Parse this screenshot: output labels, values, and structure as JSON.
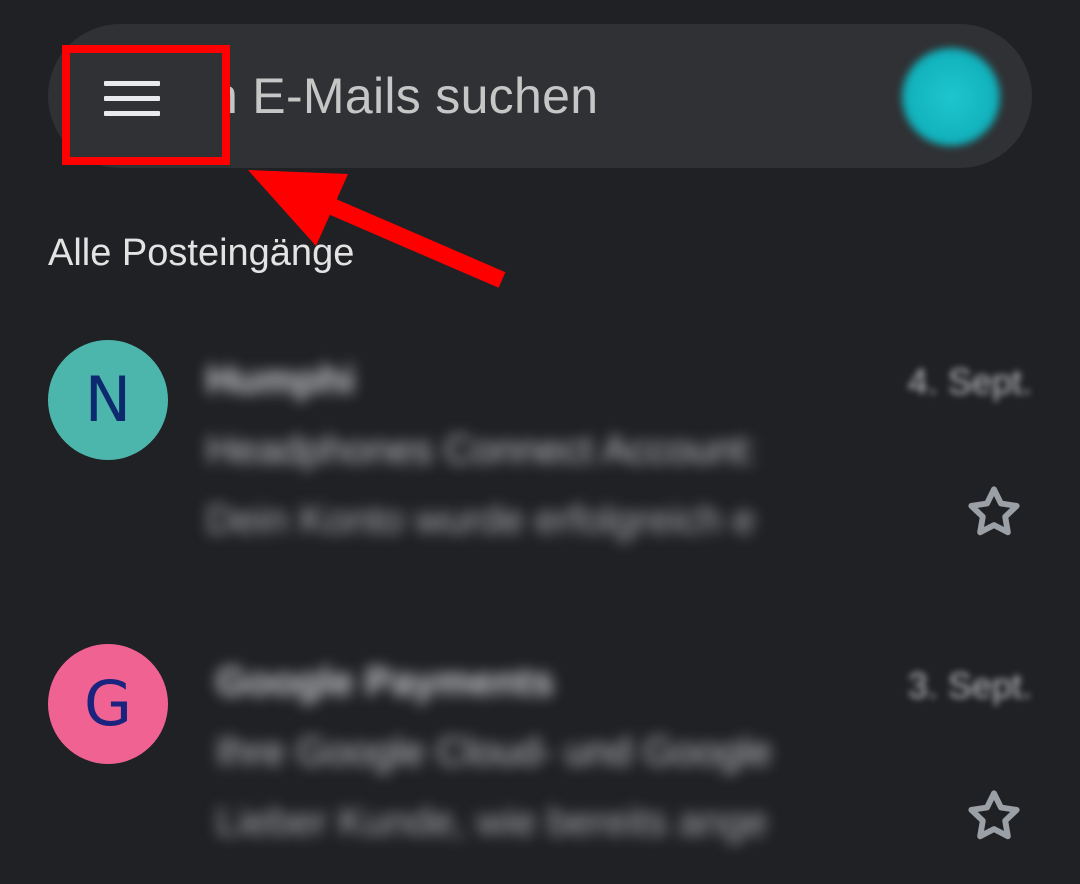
{
  "search": {
    "placeholder_visible_text": "n E-Mails suchen"
  },
  "section": {
    "title": "Alle Posteingänge"
  },
  "colors": {
    "background": "#202124",
    "search_bar": "#303134",
    "annotation": "#ff0000",
    "account_avatar": "#12b3bd"
  },
  "emails": [
    {
      "avatar_letter": "N",
      "avatar_bg": "#4db6ac",
      "avatar_fg": "#0d2a6e",
      "sender": "Humphi",
      "date": "4. Sept.",
      "subject": "Headphones Connect Account:",
      "snippet": "Dein Konto wurde erfolgreich e"
    },
    {
      "avatar_letter": "G",
      "avatar_bg": "#f06292",
      "avatar_fg": "#1a237e",
      "sender": "Google Payments",
      "date": "3. Sept.",
      "subject": "Ihre Google Cloud- und Google",
      "snippet": "Lieber Kunde, wie bereits ange"
    }
  ],
  "icons": {
    "menu": "hamburger-menu-icon",
    "star": "star-outline-icon",
    "arrow": "annotation-arrow-icon"
  }
}
